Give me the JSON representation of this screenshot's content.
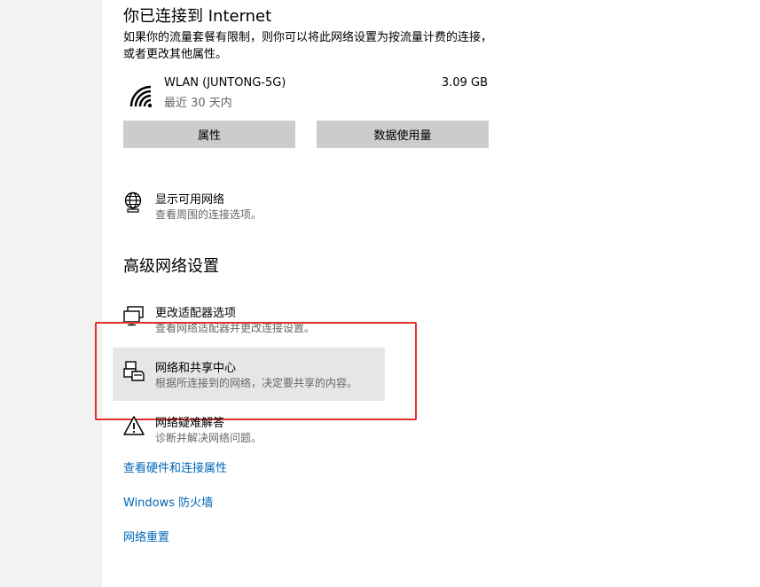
{
  "status": {
    "heading": "你已连接到 Internet",
    "description": "如果你的流量套餐有限制，则你可以将此网络设置为按流量计费的连接，或者更改其他属性。"
  },
  "connection": {
    "name": "WLAN (JUNTONG-5G)",
    "period": "最近 30 天内",
    "usage": "3.09 GB",
    "icon": "wifi-icon"
  },
  "buttons": {
    "properties": "属性",
    "data_usage": "数据使用量"
  },
  "show_networks": {
    "title": "显示可用网络",
    "subtitle": "查看周围的连接选项。",
    "icon": "globe-icon"
  },
  "advanced": {
    "heading": "高级网络设置",
    "items": [
      {
        "title": "更改适配器选项",
        "subtitle": "查看网络适配器并更改连接设置。",
        "icon": "adapter-icon"
      },
      {
        "title": "网络和共享中心",
        "subtitle": "根据所连接到的网络，决定要共享的内容。",
        "icon": "sharing-center-icon"
      },
      {
        "title": "网络疑难解答",
        "subtitle": "诊断并解决网络问题。",
        "icon": "warning-icon"
      }
    ]
  },
  "links": [
    "查看硬件和连接属性",
    "Windows 防火墙",
    "网络重置"
  ],
  "colors": {
    "link": "#0067b8",
    "button_bg": "#cccccc",
    "highlight_bg": "#e6e6e6",
    "annotation_red": "#e0312c"
  }
}
